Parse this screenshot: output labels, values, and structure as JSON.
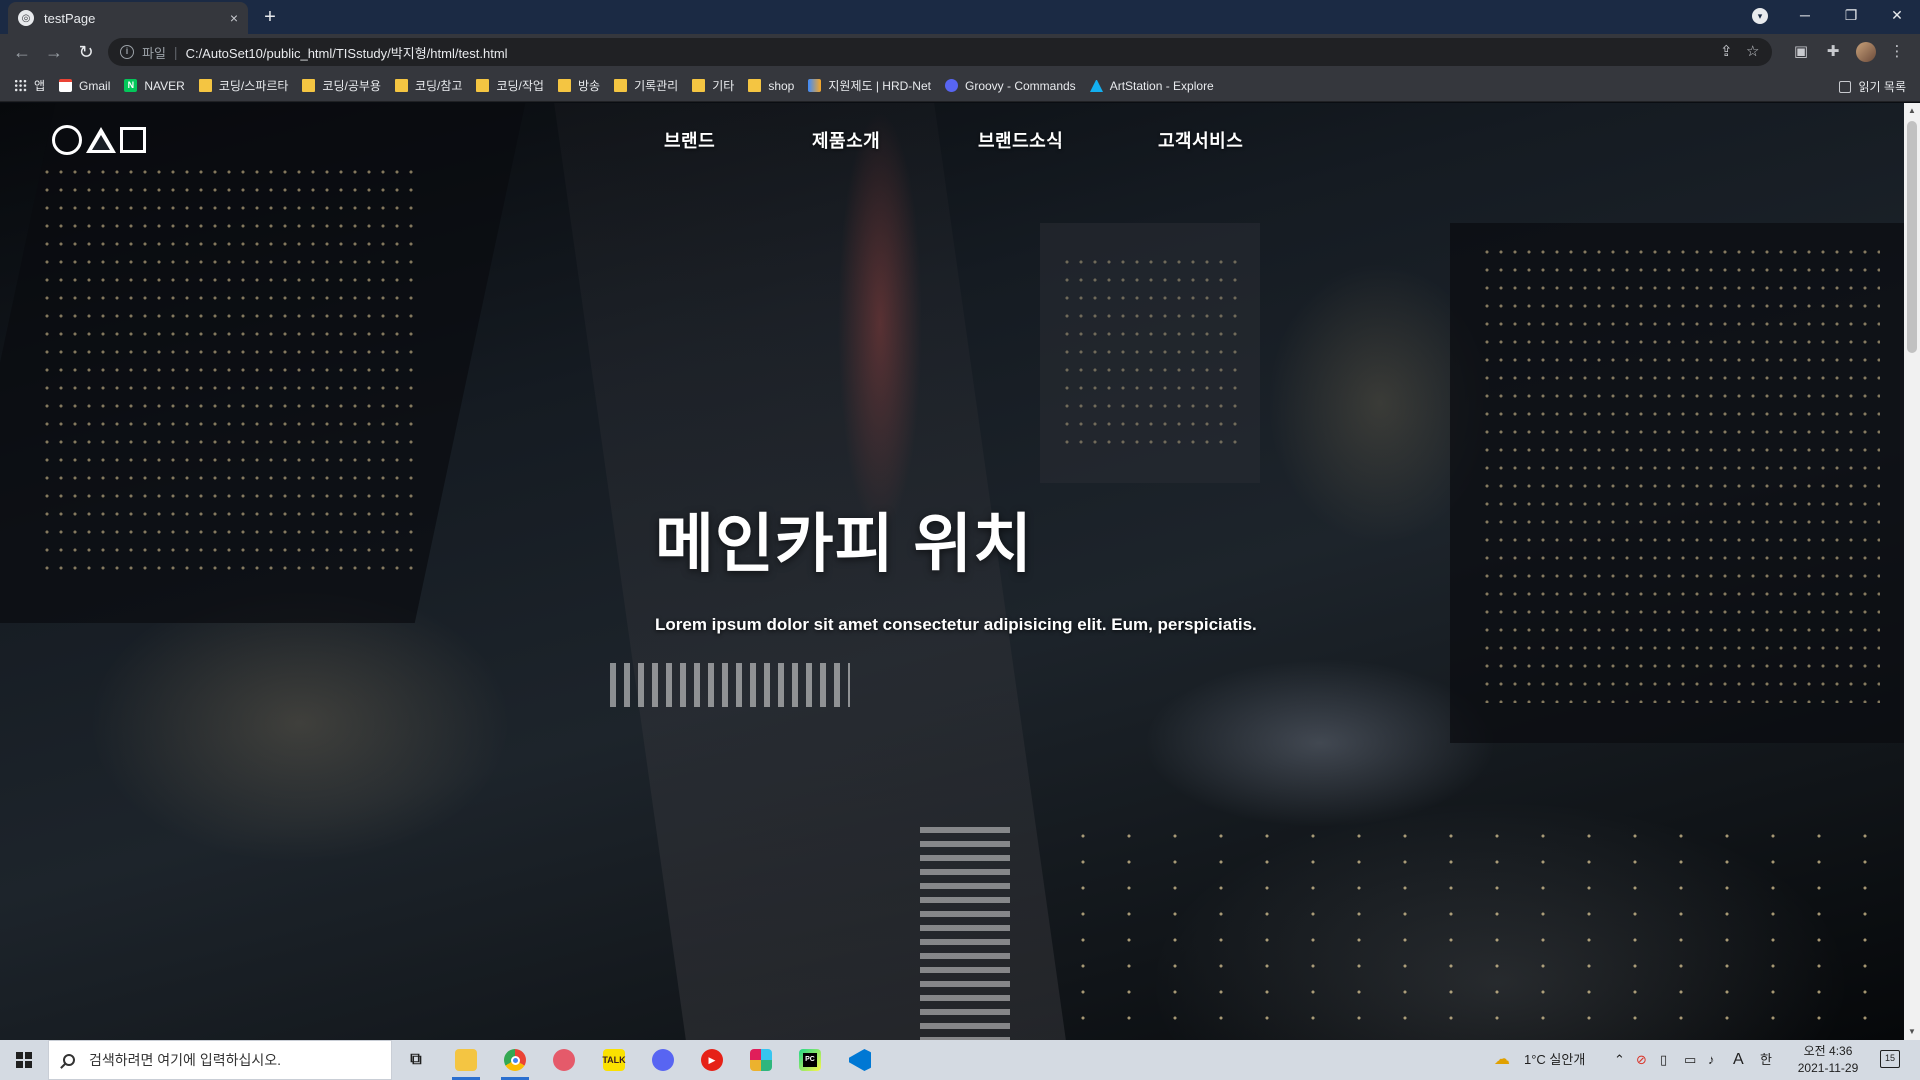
{
  "browser": {
    "tab": {
      "title": "testPage",
      "close": "×"
    },
    "new_tab": "+",
    "window_controls": {
      "minimize": "─",
      "restore": "❐",
      "close": "✕"
    },
    "nav": {
      "back": "←",
      "forward": "→",
      "reload": "↻"
    },
    "address": {
      "scheme_label": "파일",
      "url": "C:/AutoSet10/public_html/TISstudy/박지형/html/test.html"
    }
  },
  "bookmarks": {
    "items": [
      {
        "label": "앱",
        "icon": "apps-grid-icon"
      },
      {
        "label": "Gmail",
        "icon": "gmail-icon"
      },
      {
        "label": "NAVER",
        "icon": "naver-icon"
      },
      {
        "label": "코딩/스파르타",
        "icon": "folder-icon"
      },
      {
        "label": "코딩/공부용",
        "icon": "folder-icon"
      },
      {
        "label": "코딩/참고",
        "icon": "folder-icon"
      },
      {
        "label": "코딩/작업",
        "icon": "folder-icon"
      },
      {
        "label": "방송",
        "icon": "folder-icon"
      },
      {
        "label": "기록관리",
        "icon": "folder-icon"
      },
      {
        "label": "기타",
        "icon": "folder-icon"
      },
      {
        "label": "shop",
        "icon": "folder-icon"
      },
      {
        "label": "지원제도 | HRD-Net",
        "icon": "hrd-net-icon"
      },
      {
        "label": "Groovy - Commands",
        "icon": "groovy-icon"
      },
      {
        "label": "ArtStation - Explore",
        "icon": "artstation-icon"
      }
    ],
    "reading_list": "읽기 목록"
  },
  "page": {
    "nav": [
      "브랜드",
      "제품소개",
      "브랜드소식",
      "고객서비스"
    ],
    "hero_title": "메인카피 위치",
    "hero_subtitle": "Lorem ipsum dolor sit amet consectetur adipisicing elit. Eum, perspiciatis."
  },
  "taskbar": {
    "search_placeholder": "검색하려면 여기에 입력하십시오.",
    "weather": "1°C  실안개",
    "ime_a": "A",
    "ime_han": "한",
    "clock_time": "오전 4:36",
    "clock_date": "2021-11-29",
    "notification_count": "15",
    "apps": [
      "task-view",
      "file-explorer",
      "chrome",
      "snipping",
      "kakaotalk",
      "discord",
      "youtube-music",
      "slack",
      "pycharm",
      "vscode"
    ]
  },
  "colors": {
    "tabstrip": "#1b2a44",
    "toolbar": "#35373d",
    "taskbar": "#d4dae2",
    "hero_text": "#ffffff"
  }
}
